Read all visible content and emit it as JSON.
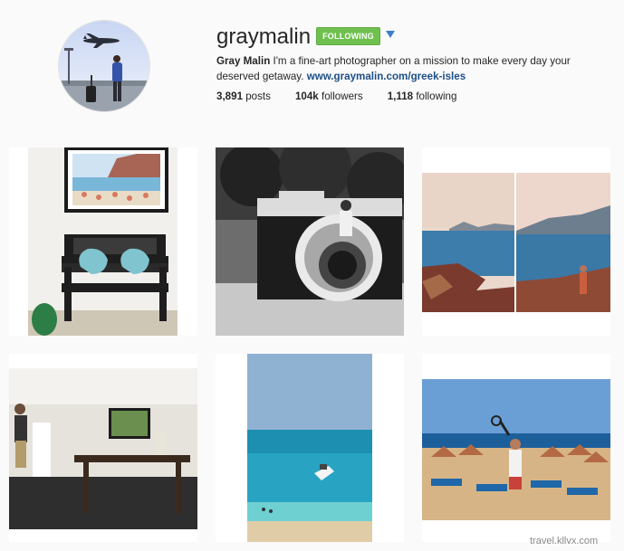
{
  "profile": {
    "username": "graymalin",
    "follow_label": "FOLLOWING",
    "bio_name": "Gray Malin",
    "bio_text": " I'm a fine-art photographer on a mission to make every day your deserved getaway. ",
    "bio_link": "www.graymalin.com/greek-isles",
    "posts_count": "3,891",
    "posts_label": " posts",
    "followers_count": "104k",
    "followers_label": " followers",
    "following_count": "1,118",
    "following_label": " following"
  },
  "posts": [
    {
      "name": "post-hallway-bench"
    },
    {
      "name": "post-camera-sculpture"
    },
    {
      "name": "post-santorini-diptych"
    },
    {
      "name": "post-villa-interior"
    },
    {
      "name": "post-boat-aerial"
    },
    {
      "name": "post-beach-umbrellas"
    }
  ],
  "watermark": "travel.kllvx.com",
  "colors": {
    "follow_green": "#70c050",
    "link_blue": "#1d4f86",
    "dropdown_blue": "#3f7fc7"
  }
}
